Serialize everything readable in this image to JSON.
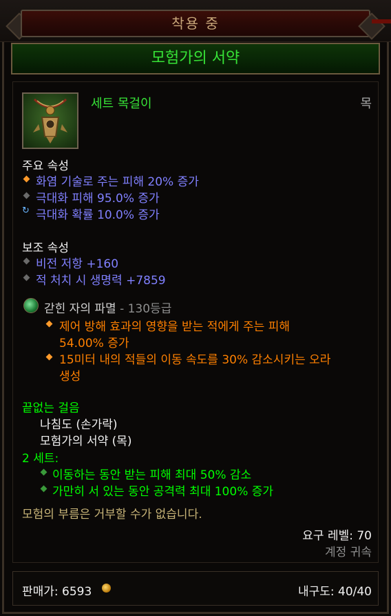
{
  "header": {
    "equipped_label": "착용 중"
  },
  "item": {
    "name": "모험가의 서약",
    "type": "세트 목걸이",
    "slot": "목",
    "icon": "necklace-icon",
    "primary": {
      "heading": "주요 속성",
      "lines": [
        "화염 기술로 주는 피해 20% 증가",
        "극대화 피해 95.0% 증가",
        "극대화 확률 10.0% 증가"
      ]
    },
    "secondary": {
      "heading": "보조 속성",
      "lines": [
        "비전 저항 +160",
        "적 처치 시 생명력 +7859"
      ]
    },
    "gem": {
      "name": "갇힌 자의 파멸",
      "rank": "- 130등급",
      "effects": [
        [
          "제어 방해 효과의 영향을 받는 적에게 주는 피해",
          "54.00% 증가"
        ],
        [
          "15미터 내의 적들의 이동 속도를 30% 감소시키는 오라",
          "생성"
        ]
      ]
    },
    "set": {
      "name": "끝없는 걸음",
      "pieces": [
        "나침도 (손가락)",
        "모험가의 서약 (목)"
      ],
      "bonus_label": "2 세트:",
      "bonuses": [
        "이동하는 동안 받는 피해 최대 50% 감소",
        "가만히 서 있는 동안 공격력 최대 100% 증가"
      ]
    },
    "flavor": "모험의 부름은 거부할 수가 없습니다.",
    "required_level": "요구 레벨: 70",
    "bound": "계정 귀속",
    "sell_price_label": "판매가: 6593",
    "durability": "내구도: 40/40"
  },
  "colors": {
    "set_green": "#00ff00",
    "magic_blue": "#8080ff",
    "legendary_orange": "#ff8000",
    "flavor_gold": "#c7b377"
  }
}
